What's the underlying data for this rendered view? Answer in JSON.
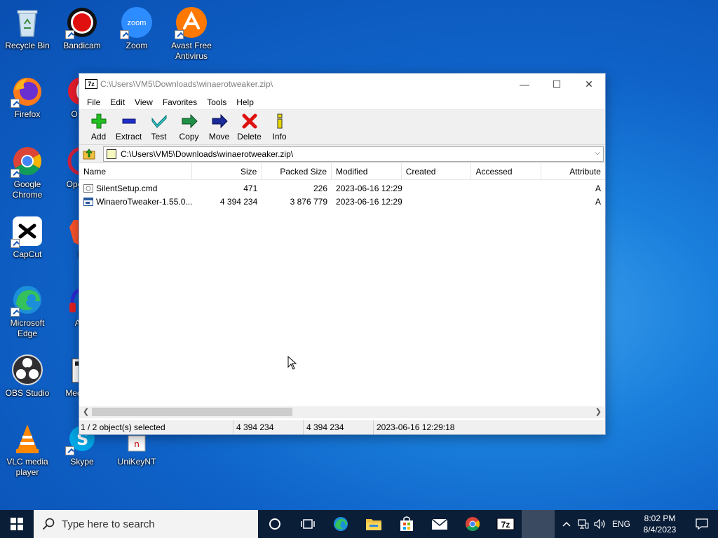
{
  "desktop": {
    "icons": [
      {
        "label": "Recycle Bin"
      },
      {
        "label": "Bandicam"
      },
      {
        "label": "Zoom",
        "sub": "zoom"
      },
      {
        "label": "Avast Free Antivirus"
      },
      {
        "label": "Firefox"
      },
      {
        "label": "O Bro"
      },
      {
        "label": "Google Chrome"
      },
      {
        "label": "Ope Bro"
      },
      {
        "label": "CapCut"
      },
      {
        "label": "Br"
      },
      {
        "label": "Microsoft Edge"
      },
      {
        "label": "Auc"
      },
      {
        "label": "OBS Studio"
      },
      {
        "label": "Media Cl"
      },
      {
        "label": "VLC media player"
      },
      {
        "label": "Skype"
      },
      {
        "label": "UniKeyNT"
      }
    ]
  },
  "window": {
    "title": "C:\\Users\\VM5\\Downloads\\winaerotweaker.zip\\",
    "app_badge": "7z",
    "controls": {
      "minimize": "—",
      "maximize": "☐",
      "close": "✕"
    },
    "menu": [
      "File",
      "Edit",
      "View",
      "Favorites",
      "Tools",
      "Help"
    ],
    "toolbar": {
      "add": "Add",
      "extract": "Extract",
      "test": "Test",
      "copy": "Copy",
      "move": "Move",
      "delete": "Delete",
      "info": "Info"
    },
    "address": "C:\\Users\\VM5\\Downloads\\winaerotweaker.zip\\",
    "columns": {
      "name": "Name",
      "size": "Size",
      "packed": "Packed Size",
      "modified": "Modified",
      "created": "Created",
      "accessed": "Accessed",
      "attributes": "Attribute"
    },
    "files": [
      {
        "name": "SilentSetup.cmd",
        "size": "471",
        "packed": "226",
        "modified": "2023-06-16 12:29",
        "created": "",
        "accessed": "",
        "attr": "A"
      },
      {
        "name": "WinaeroTweaker-1.55.0....",
        "size": "4 394 234",
        "packed": "3 876 779",
        "modified": "2023-06-16 12:29",
        "created": "",
        "accessed": "",
        "attr": "A"
      }
    ],
    "status": {
      "selection": "1 / 2 object(s) selected",
      "size": "4 394 234",
      "packed": "4 394 234",
      "modified": "2023-06-16 12:29:18"
    }
  },
  "taskbar": {
    "search_placeholder": "Type here to search",
    "pinned": [
      "task-view",
      "edge",
      "file-explorer",
      "microsoft-store",
      "mail",
      "chrome",
      "7zip",
      "active-window"
    ],
    "sevenzip_badge": "7z",
    "tray": {
      "language": "ENG",
      "time": "8:02 PM",
      "date": "8/4/2023"
    }
  }
}
